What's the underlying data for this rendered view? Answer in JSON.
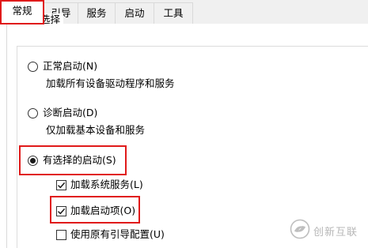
{
  "tabs": [
    {
      "label": "常规",
      "active": true
    },
    {
      "label": "引导",
      "active": false
    },
    {
      "label": "服务",
      "active": false
    },
    {
      "label": "启动",
      "active": false
    },
    {
      "label": "工具",
      "active": false
    }
  ],
  "startup_group": {
    "legend": "启动选择",
    "options": [
      {
        "label": "正常启动(N)",
        "description": "加载所有设备驱动程序和服务",
        "selected": false
      },
      {
        "label": "诊断启动(D)",
        "description": "仅加载基本设备和服务",
        "selected": false
      },
      {
        "label": "有选择的启动(S)",
        "selected": true
      }
    ],
    "selective_items": [
      {
        "label": "加载系统服务(L)",
        "checked": true
      },
      {
        "label": "加载启动项(O)",
        "checked": true
      },
      {
        "label": "使用原有引导配置(U)",
        "checked": false
      }
    ]
  },
  "annotation_color": "#e01a1a",
  "watermark": {
    "text": "创新互联",
    "icon": "swirl-logo-icon"
  }
}
